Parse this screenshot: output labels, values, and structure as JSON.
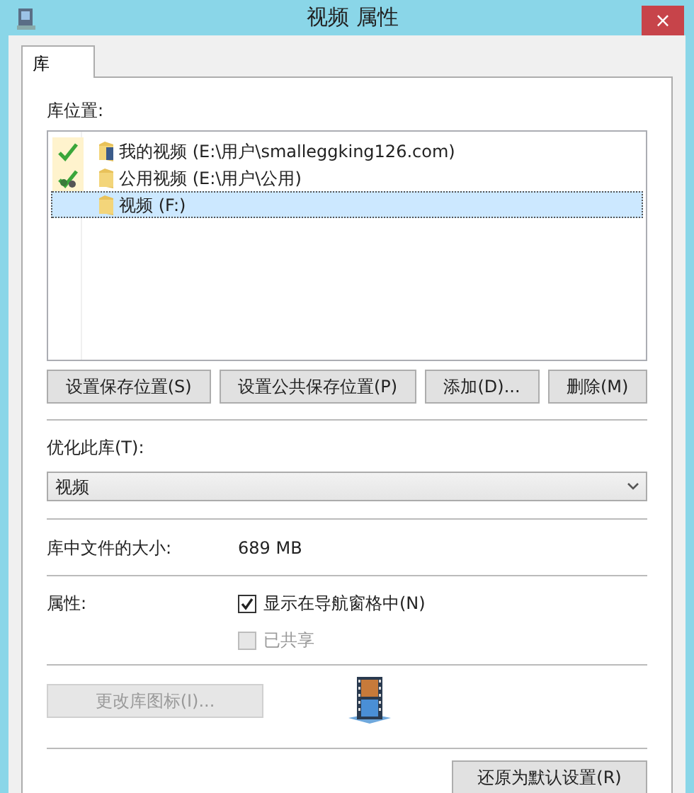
{
  "window": {
    "title": "视频 属性",
    "close": "×"
  },
  "tabs": [
    {
      "label": "库",
      "selected": true
    }
  ],
  "locations_label": "库位置:",
  "locations": [
    {
      "name": "我的视频 (E:\\用户\\smalleggking126.com)",
      "kind": "save",
      "selected": false
    },
    {
      "name": "公用视频 (E:\\用户\\公用)",
      "kind": "public",
      "selected": false
    },
    {
      "name": "视频 (F:)",
      "kind": "plain",
      "selected": true
    }
  ],
  "location_buttons": [
    {
      "label": "设置保存位置(S)",
      "disabled": false
    },
    {
      "label": "设置公共保存位置(P)",
      "disabled": false
    },
    {
      "label": "添加(D)...",
      "disabled": false
    },
    {
      "label": "删除(M)",
      "disabled": false
    }
  ],
  "optimize": {
    "label": "优化此库(T):",
    "value": "视频"
  },
  "size": {
    "label": "库中文件的大小:",
    "value": "689 MB"
  },
  "attributes": {
    "label": "属性:",
    "options": [
      {
        "label": "显示在导航窗格中(N)",
        "checked": true,
        "disabled": false
      },
      {
        "label": "已共享",
        "checked": false,
        "disabled": true
      }
    ]
  },
  "change_icon_button": {
    "label": "更改库图标(I)...",
    "disabled": true
  },
  "restore_button": {
    "label": "还原为默认设置(R)"
  }
}
